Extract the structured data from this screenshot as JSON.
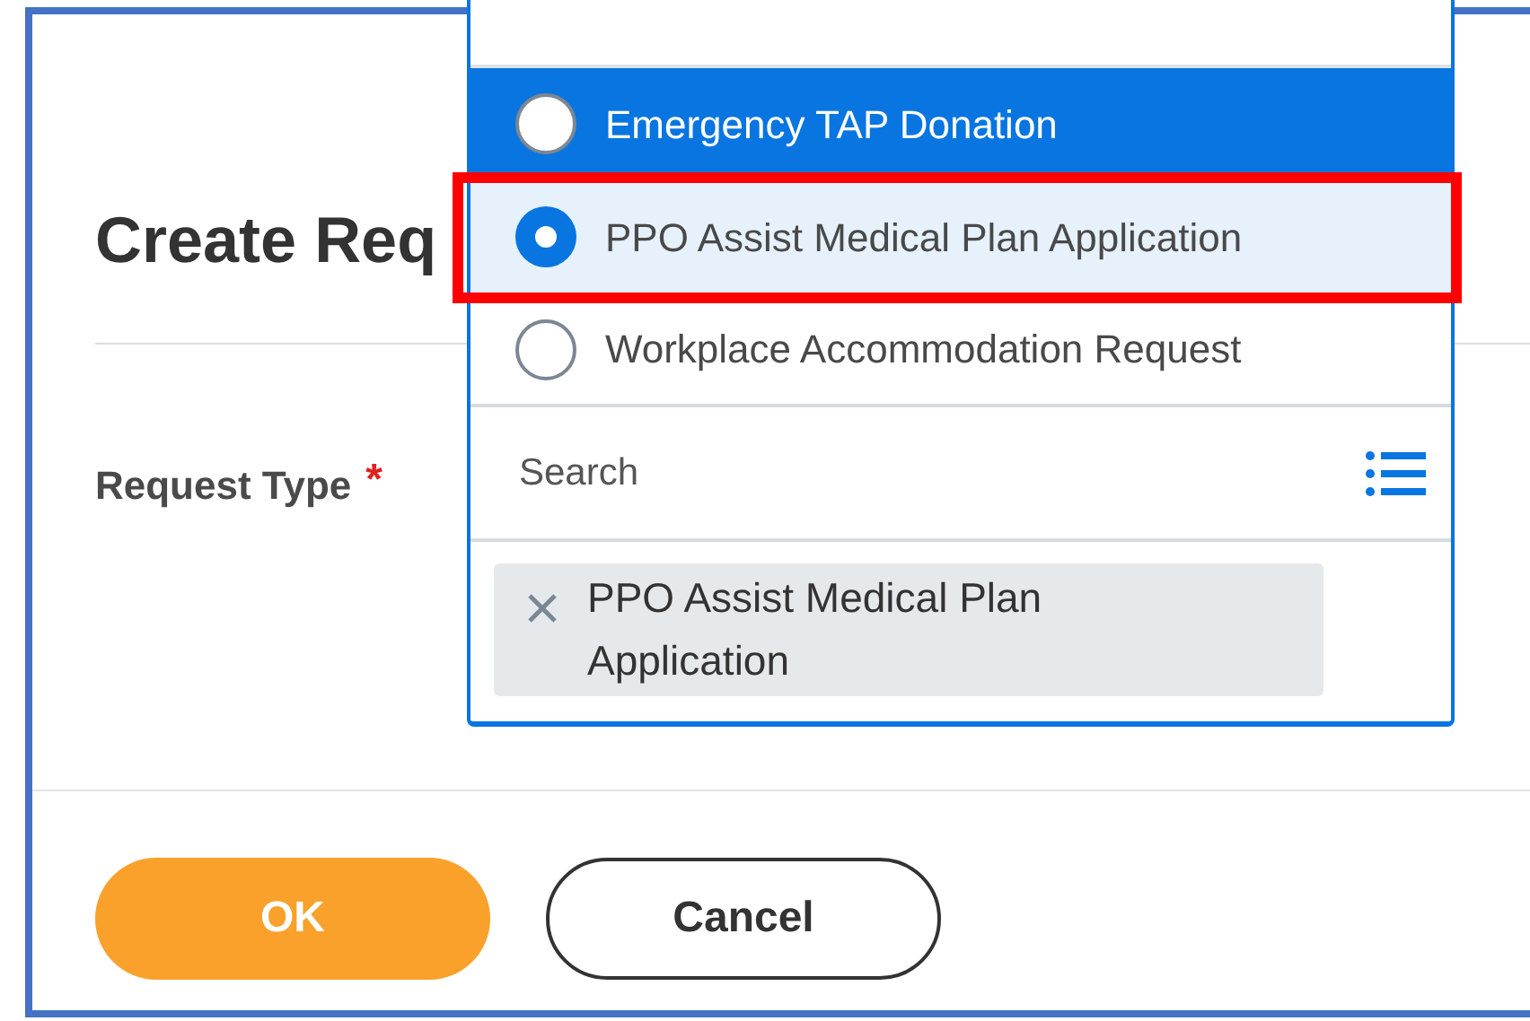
{
  "dialog": {
    "title": "Create Req"
  },
  "form": {
    "label": "Request Type",
    "required_mark": "*"
  },
  "dropdown": {
    "options": [
      {
        "label": "Emergency TAP Donation",
        "selected": false,
        "highlighted": true,
        "outlined": false
      },
      {
        "label": "PPO Assist Medical Plan Application",
        "selected": true,
        "highlighted": false,
        "outlined": true
      },
      {
        "label": "Workplace Accommodation Request",
        "selected": false,
        "highlighted": false,
        "outlined": false
      }
    ],
    "search": {
      "placeholder": "Search"
    },
    "chips": [
      {
        "label": "PPO Assist Medical Plan Application"
      }
    ]
  },
  "buttons": [
    {
      "label": "OK",
      "kind": "primary"
    },
    {
      "label": "Cancel",
      "kind": "secondary"
    }
  ]
}
